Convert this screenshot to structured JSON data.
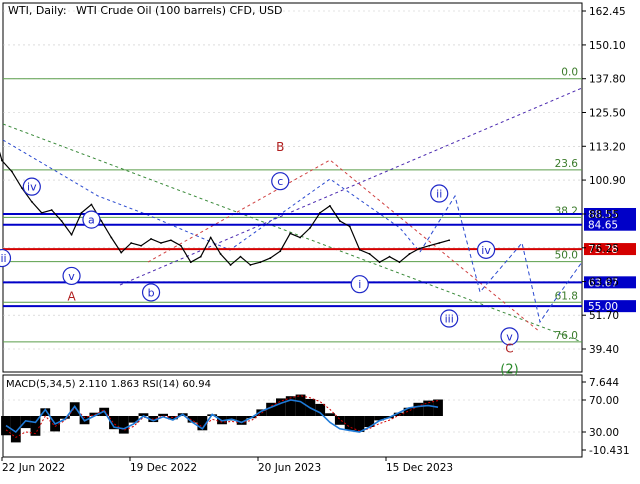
{
  "header": {
    "symbol": "WTI, Daily:",
    "description": "WTI Crude Oil (100 barrels) CFD, USD"
  },
  "colors": {
    "price": "#000000",
    "fib_line": "#5a9e4a",
    "fib_label": "#3a7a2a",
    "level_blue": "#0000c8",
    "level_red": "#d40000",
    "wave_blue": "#1e28c8",
    "wave_red": "#b01e1e",
    "wave_green": "#2a8a2a",
    "grid": "#c8c8c8",
    "macd_hist": "#000000",
    "macd_signal": "#d40000",
    "rsi": "#1e7ad8"
  },
  "chart_data": [
    {
      "type": "line",
      "ylim": [
        33.0,
        169.0
      ],
      "y_ticks": [
        "162.45",
        "150.10",
        "137.80",
        "125.50",
        "113.20",
        "100.90",
        "88.55",
        "76.25",
        "63.95",
        "51.70",
        "39.40"
      ],
      "y_tick_values": [
        162.45,
        150.1,
        137.8,
        125.5,
        113.2,
        100.9,
        88.55,
        76.25,
        63.95,
        51.7,
        39.4
      ],
      "x_ticks": [
        "22 Jun 2022",
        "19 Dec 2022",
        "20 Jun 2023",
        "15 Dec 2023"
      ],
      "x_tick_dates": [
        "2022-06-22",
        "2022-12-19",
        "2023-06-20",
        "2023-12-15"
      ],
      "series": [
        {
          "x": [
            "2022-06-08",
            "2022-06-22",
            "2022-07-06",
            "2022-07-20",
            "2022-08-03",
            "2022-08-17",
            "2022-08-31",
            "2022-09-14",
            "2022-09-28",
            "2022-10-12",
            "2022-10-26",
            "2022-11-09",
            "2022-11-23",
            "2022-12-07",
            "2022-12-21",
            "2023-01-04",
            "2023-01-18",
            "2023-02-01",
            "2023-02-15",
            "2023-03-01",
            "2023-03-15",
            "2023-03-29",
            "2023-04-12",
            "2023-04-26",
            "2023-05-10",
            "2023-05-24",
            "2023-06-07",
            "2023-06-21",
            "2023-07-05",
            "2023-07-19",
            "2023-08-02",
            "2023-08-16",
            "2023-08-30",
            "2023-09-13",
            "2023-09-27",
            "2023-10-11",
            "2023-10-25",
            "2023-11-08",
            "2023-11-22",
            "2023-12-06",
            "2023-12-20",
            "2024-01-03",
            "2024-01-17",
            "2024-01-31",
            "2024-02-14",
            "2024-02-28",
            "2024-03-13"
          ],
          "values": [
            120.5,
            108.0,
            104.0,
            98.0,
            93.0,
            89.0,
            90.0,
            86.0,
            81.0,
            89.0,
            92.0,
            86.0,
            80.0,
            74.5,
            78.0,
            77.0,
            79.5,
            78.0,
            79.0,
            77.0,
            71.0,
            73.0,
            80.0,
            74.0,
            70.0,
            73.0,
            70.0,
            71.0,
            72.5,
            75.0,
            81.5,
            80.0,
            83.5,
            89.0,
            91.5,
            86.0,
            84.0,
            75.5,
            74.0,
            71.0,
            73.0,
            71.0,
            74.0,
            76.0,
            77.0,
            78.0,
            79.0
          ]
        }
      ],
      "fib_levels": [
        {
          "label": "0.0",
          "value": 137.8
        },
        {
          "label": "23.6",
          "value": 104.6
        },
        {
          "label": "38.2",
          "value": 87.3
        },
        {
          "label": "50.0",
          "value": 71.2
        },
        {
          "label": "61.8",
          "value": 56.4
        },
        {
          "label": "76.0",
          "value": 42.0
        }
      ],
      "price_levels": [
        {
          "label": "88.55",
          "value": 88.55,
          "color": "blue"
        },
        {
          "label": "84.65",
          "value": 84.65,
          "color": "blue"
        },
        {
          "label": "75.78",
          "value": 75.78,
          "color": "red"
        },
        {
          "label": "63.67",
          "value": 63.67,
          "color": "blue"
        },
        {
          "label": "55.00",
          "value": 55.0,
          "color": "blue"
        }
      ],
      "wave_labels": [
        {
          "text": "iv",
          "style": "blue-circle",
          "date": "2022-08-03",
          "value": 98.5
        },
        {
          "text": "iii",
          "style": "blue-circle",
          "date": "2022-06-22",
          "value": 72.5
        },
        {
          "text": "a",
          "style": "blue-circle",
          "date": "2022-10-26",
          "value": 86.5
        },
        {
          "text": "v",
          "style": "blue-circle",
          "date": "2022-09-28",
          "value": 66.0
        },
        {
          "text": "A",
          "style": "red",
          "date": "2022-09-28",
          "value": 58.5
        },
        {
          "text": "b",
          "style": "blue-circle",
          "date": "2023-01-18",
          "value": 60.0
        },
        {
          "text": "B",
          "style": "red",
          "date": "2023-07-19",
          "value": 113.0
        },
        {
          "text": "c",
          "style": "blue-circle",
          "date": "2023-07-19",
          "value": 100.5
        },
        {
          "text": "i",
          "style": "blue-circle",
          "date": "2023-11-08",
          "value": 63.0
        },
        {
          "text": "ii",
          "style": "blue-circle",
          "date": "2024-02-28",
          "value": 96.0
        },
        {
          "text": "iii",
          "style": "blue-circle",
          "date": "2024-03-13",
          "value": 50.5
        },
        {
          "text": "iv",
          "style": "blue-circle",
          "date": "2024-05-04",
          "value": 75.5
        },
        {
          "text": "v",
          "style": "blue-circle",
          "date": "2024-06-06",
          "value": 44.0
        },
        {
          "text": "C",
          "style": "red",
          "date": "2024-06-06",
          "value": 39.5
        },
        {
          "text": "(2)",
          "style": "green",
          "date": "2024-06-06",
          "value": 32.0
        }
      ]
    },
    {
      "type": "line",
      "title": "MACD(5,34,5) 2.110 1.863 RSI(14) 60.94",
      "y_ticks": [
        "7.644",
        "70.00",
        "30.00",
        "-10.431"
      ],
      "ylim": [
        -10.431,
        7.644
      ],
      "rsi_range": [
        20,
        80
      ],
      "series": [
        {
          "name": "MACD",
          "values": [
            -3.5,
            -4.8,
            -2.2,
            -3.6,
            1.4,
            -2.8,
            -0.5,
            2.5,
            -1.5,
            0.6,
            1.5,
            -2.4,
            -3.2,
            -1.2,
            0.5,
            -1.1,
            0.4,
            -0.6,
            0.5,
            -1.2,
            -2.6,
            0.3,
            -1.5,
            -0.8,
            -1.6,
            -0.4,
            1.2,
            2.4,
            3.2,
            3.6,
            3.9,
            3.1,
            2.2,
            0.5,
            -1.6,
            -2.6,
            -2.9,
            -2.0,
            -0.8,
            -0.4,
            0.6,
            1.5,
            2.4,
            2.8,
            3.0
          ]
        },
        {
          "name": "Signal",
          "values": [
            -2.5,
            -3.9,
            -2.9,
            -3.2,
            0.0,
            -1.9,
            -0.8,
            1.5,
            -0.3,
            0.2,
            1.1,
            -1.4,
            -2.6,
            -1.9,
            -0.2,
            -0.6,
            0.0,
            -0.3,
            0.2,
            -0.8,
            -2.0,
            -0.6,
            -1.1,
            -1.0,
            -1.2,
            -0.8,
            0.5,
            1.8,
            2.7,
            3.3,
            3.7,
            3.3,
            2.6,
            1.2,
            -0.6,
            -2.0,
            -2.7,
            -2.3,
            -1.4,
            -0.8,
            0.1,
            0.9,
            1.8,
            2.4,
            2.8
          ]
        },
        {
          "name": "RSI",
          "values": [
            38,
            30,
            44,
            42,
            58,
            40,
            46,
            62,
            44,
            50,
            56,
            36,
            34,
            40,
            50,
            44,
            49,
            45,
            52,
            42,
            34,
            52,
            44,
            46,
            42,
            48,
            56,
            61,
            66,
            70,
            68,
            60,
            54,
            42,
            34,
            32,
            30,
            36,
            44,
            48,
            54,
            60,
            62,
            63,
            61
          ]
        }
      ]
    }
  ]
}
